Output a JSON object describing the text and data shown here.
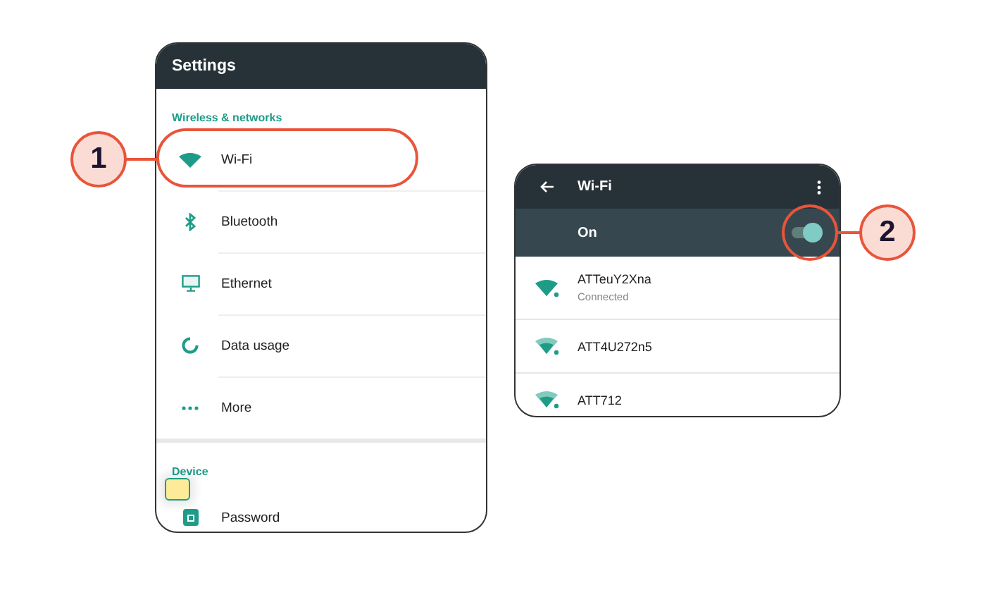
{
  "settings_screen": {
    "title": "Settings",
    "sections": [
      {
        "header": "Wireless & networks",
        "items": [
          {
            "label": "Wi-Fi",
            "kind": "wifi"
          },
          {
            "label": "Bluetooth",
            "kind": "bluetooth"
          },
          {
            "label": "Ethernet",
            "kind": "ethernet"
          },
          {
            "label": "Data usage",
            "kind": "data"
          },
          {
            "label": "More",
            "kind": "more"
          }
        ]
      },
      {
        "header": "Device",
        "items": [
          {
            "label": "Password",
            "kind": "password"
          }
        ]
      }
    ]
  },
  "wifi_screen": {
    "title": "Wi-Fi",
    "toggle": {
      "label": "On",
      "on": true
    },
    "networks": [
      {
        "name": "ATTeuY2Xna",
        "status": "Connected"
      },
      {
        "name": "ATT4U272n5"
      },
      {
        "name": "ATT712"
      }
    ]
  },
  "callouts": [
    {
      "number": "1"
    },
    {
      "number": "2"
    }
  ]
}
